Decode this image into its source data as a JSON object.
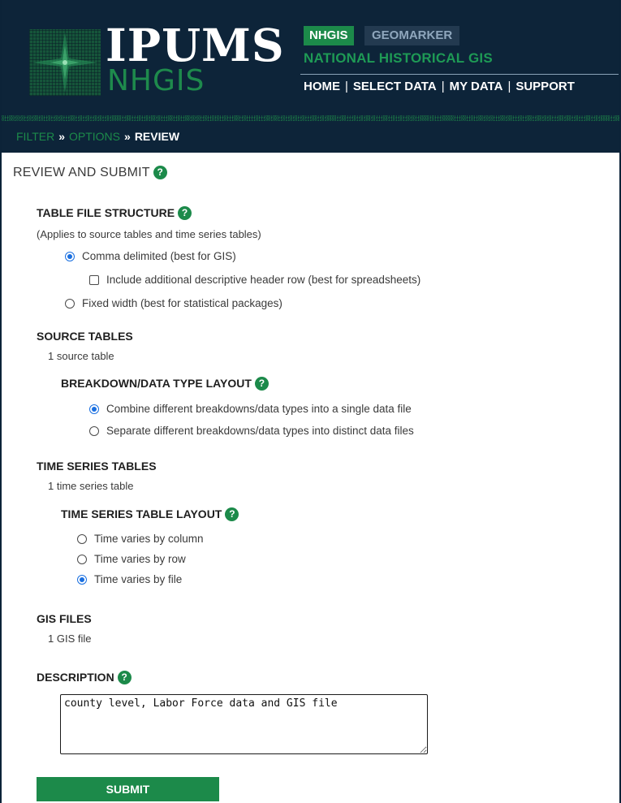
{
  "header": {
    "logo_top": "IPUMS",
    "logo_bottom": "NHGIS",
    "tab_active": "NHGIS",
    "tab_inactive": "GEOMARKER",
    "subtitle": "NATIONAL HISTORICAL GIS",
    "nav": [
      "HOME",
      "SELECT DATA",
      "MY DATA",
      "SUPPORT"
    ]
  },
  "breadcrumb": {
    "filter": "FILTER",
    "options": "OPTIONS",
    "review": "REVIEW",
    "separator": "»"
  },
  "page": {
    "title": "REVIEW AND SUBMIT",
    "help_glyph": "?"
  },
  "table_file_structure": {
    "heading": "TABLE FILE STRUCTURE",
    "note": "(Applies to source tables and time series tables)",
    "comma": "Comma delimited (best for GIS)",
    "header_row": "Include additional descriptive header row (best for spreadsheets)",
    "fixed": "Fixed width (best for statistical packages)"
  },
  "source_tables": {
    "heading": "SOURCE TABLES",
    "count": "1 source table",
    "layout_heading": "BREAKDOWN/DATA TYPE LAYOUT",
    "combine": "Combine different breakdowns/data types into a single data file",
    "separate": "Separate different breakdowns/data types into distinct data files"
  },
  "time_series": {
    "heading": "TIME SERIES TABLES",
    "count": "1 time series table",
    "layout_heading": "TIME SERIES TABLE LAYOUT",
    "by_column": "Time varies by column",
    "by_row": "Time varies by row",
    "by_file": "Time varies by file"
  },
  "gis_files": {
    "heading": "GIS FILES",
    "count": "1 GIS file"
  },
  "description": {
    "heading": "DESCRIPTION",
    "value": "county level, Labor Force data and GIS file"
  },
  "submit_label": "SUBMIT",
  "binary_strip": "01100101011010010110110101110011011011010110100001100111011010010111001101100101011011010110111001101111011100100110110101101110011010000110011101101001011100110110110101100001011100000111001101100101011100100111011001100101011100100110111001101000011001110110100101110011",
  "colors": {
    "header_bg": "#0d2439",
    "accent_green": "#1c8a4a",
    "radio_blue": "#1a6fe0"
  }
}
